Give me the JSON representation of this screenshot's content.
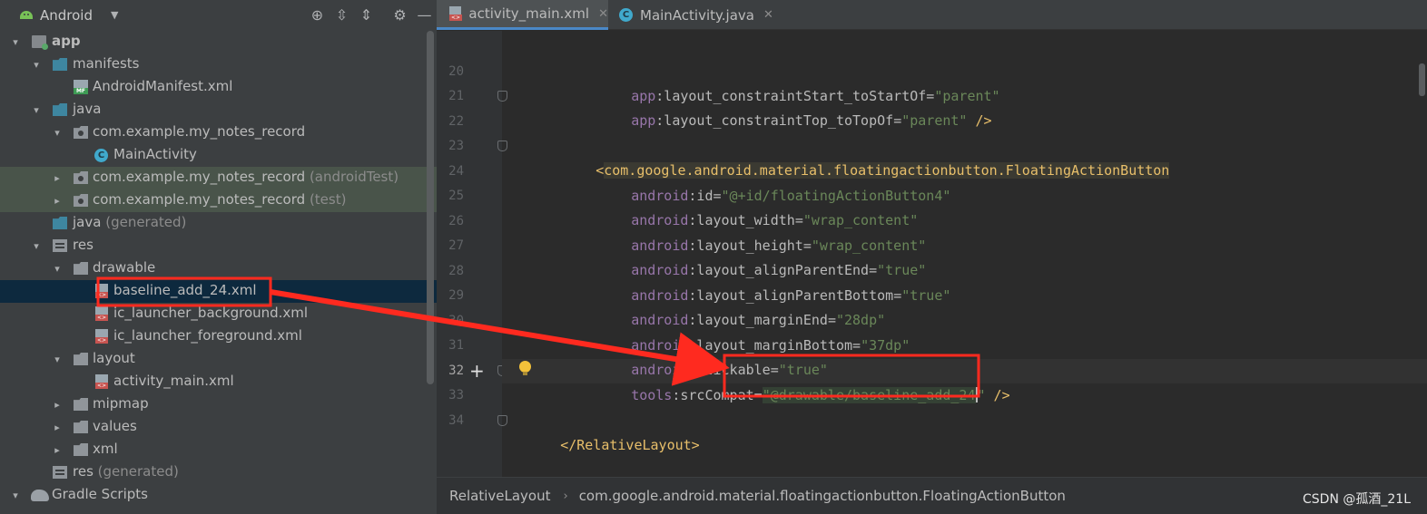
{
  "panel": {
    "view_selector": "Android",
    "tool_icons": [
      "target-icon",
      "expand-all-icon",
      "collapse-all-icon",
      "gear-icon",
      "minimize-icon"
    ]
  },
  "tree": [
    {
      "label": "app",
      "hint": "",
      "bold": true
    },
    {
      "label": "manifests",
      "hint": ""
    },
    {
      "label": "AndroidManifest.xml",
      "hint": ""
    },
    {
      "label": "java",
      "hint": ""
    },
    {
      "label": "com.example.my_notes_record",
      "hint": ""
    },
    {
      "label": "MainActivity",
      "hint": ""
    },
    {
      "label": "com.example.my_notes_record",
      "hint": "(androidTest)"
    },
    {
      "label": "com.example.my_notes_record",
      "hint": "(test)"
    },
    {
      "label": "java",
      "hint": "(generated)"
    },
    {
      "label": "res",
      "hint": ""
    },
    {
      "label": "drawable",
      "hint": ""
    },
    {
      "label": "baseline_add_24.xml",
      "hint": ""
    },
    {
      "label": "ic_launcher_background.xml",
      "hint": ""
    },
    {
      "label": "ic_launcher_foreground.xml",
      "hint": ""
    },
    {
      "label": "layout",
      "hint": ""
    },
    {
      "label": "activity_main.xml",
      "hint": ""
    },
    {
      "label": "mipmap",
      "hint": ""
    },
    {
      "label": "values",
      "hint": ""
    },
    {
      "label": "xml",
      "hint": ""
    },
    {
      "label": "res",
      "hint": "(generated)"
    },
    {
      "label": "Gradle Scripts",
      "hint": ""
    }
  ],
  "tabs": [
    {
      "label": "activity_main.xml",
      "active": true
    },
    {
      "label": "MainActivity.java",
      "active": false
    }
  ],
  "code": {
    "line_numbers": [
      "20",
      "21",
      "22",
      "23",
      "24",
      "25",
      "26",
      "27",
      "28",
      "29",
      "30",
      "31",
      "32",
      "33",
      "34"
    ],
    "l20": {
      "ns": "app",
      "attr": ":layout_constraintStart_toStartOf",
      "val": "\"parent\""
    },
    "l21": {
      "ns": "app",
      "attr": ":layout_constraintTop_toTopOf",
      "val": "\"parent\"",
      "end": " />"
    },
    "l23": {
      "open": "<",
      "tag": "com.google.android.material.floatingactionbutton.FloatingActionButton"
    },
    "l24": {
      "ns": "android",
      "attr": ":id",
      "val": "\"@+id/floatingActionButton4\""
    },
    "l25": {
      "ns": "android",
      "attr": ":layout_width",
      "val": "\"wrap_content\""
    },
    "l26": {
      "ns": "android",
      "attr": ":layout_height",
      "val": "\"wrap_content\""
    },
    "l27": {
      "ns": "android",
      "attr": ":layout_alignParentEnd",
      "val": "\"true\""
    },
    "l28": {
      "ns": "android",
      "attr": ":layout_alignParentBottom",
      "val": "\"true\""
    },
    "l29": {
      "ns": "android",
      "attr": ":layout_marginEnd",
      "val": "\"28dp\""
    },
    "l30": {
      "ns": "android",
      "attr": ":layout_marginBottom",
      "val": "\"37dp\""
    },
    "l31": {
      "ns": "android",
      "attr": ":clickable",
      "val": "\"true\""
    },
    "l32": {
      "ns": "tools",
      "attr": ":srcCompat",
      "quote_open": "\"",
      "val": "@drawable/baseline_add_24",
      "quote_close": "\"",
      "end": " />"
    },
    "l34": {
      "close": "</RelativeLayout>"
    }
  },
  "breadcrumb": {
    "item1": "RelativeLayout",
    "item2": "com.google.android.material.floatingactionbutton.FloatingActionButton"
  },
  "watermark": "CSDN @孤酒_21L",
  "colors": {
    "annotation": "#ff2a1f",
    "selection": "#0d293e",
    "accent": "#4a88c7"
  }
}
